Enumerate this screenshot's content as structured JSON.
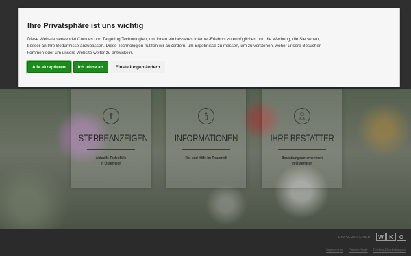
{
  "cookie_banner": {
    "title": "Ihre Privatsphäre ist uns wichtig",
    "text_line1": "Diese Website verwendet Cookies und Targeting Technologien, um Ihnen ein besseres Internet-Erlebnis zu ermöglichen und die Werbung, die Sie sehen,",
    "text_line2": "besser an Ihre Bedürfnisse anzupassen. Diese Technologien nutzen wir außerdem, um Ergebnisse zu messen, um zu verstehen, woher unsere Besucher",
    "text_line3": "kommen oder um unsere Website weiter zu entwickeln.",
    "accept_label": "Alle akzeptieren",
    "reject_label": "Ich lehne ab",
    "settings_label": "Einstellungen ändern",
    "accent_color": "#1c8c1c"
  },
  "tiles": [
    {
      "icon": "cross-icon",
      "title": "STERBEANZEIGEN",
      "sub_line1": "Aktuelle Todesfälle",
      "sub_line2": "in Österreich"
    },
    {
      "icon": "candle-icon",
      "title": "INFORMATIONEN",
      "sub_line1": "Rat und Hilfe im Trauerfall",
      "sub_line2": ""
    },
    {
      "icon": "person-icon",
      "title": "IHRE BESTATTER",
      "sub_line1": "Bestattungsunternehmen",
      "sub_line2": "in Österreich"
    }
  ],
  "footer": {
    "label": "EIN SERVICE DER",
    "wko_letters": [
      "W",
      "K",
      "O"
    ],
    "links": [
      "Impressum",
      "Datenschutz",
      "Cookie-Einstellungen"
    ]
  }
}
